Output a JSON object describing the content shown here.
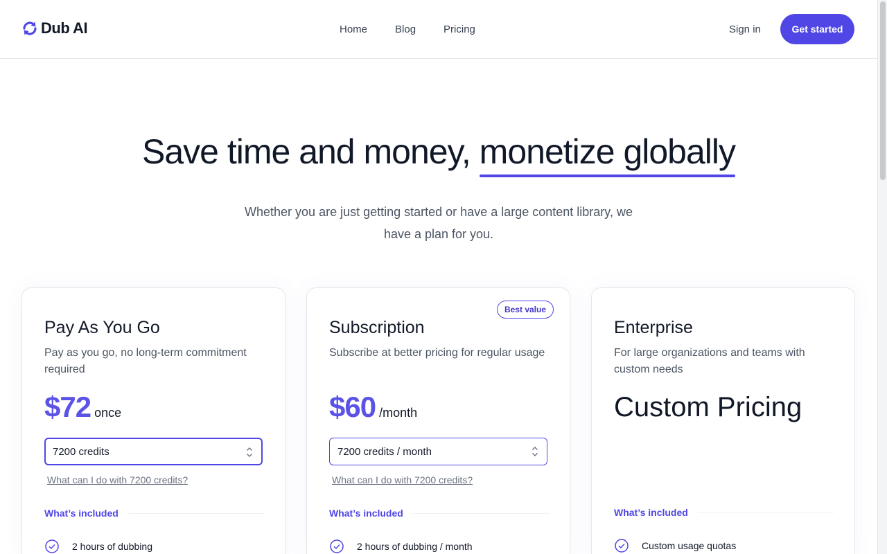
{
  "header": {
    "brand": "Dub AI",
    "nav": [
      "Home",
      "Blog",
      "Pricing"
    ],
    "sign_in": "Sign in",
    "get_started": "Get started"
  },
  "hero": {
    "title_plain": "Save time and money,",
    "title_highlight": "monetize globally",
    "subtitle": "Whether you are just getting started or have a large content library, we have a plan for you."
  },
  "plans": [
    {
      "title": "Pay As You Go",
      "description": "Pay as you go, no long-term commitment required",
      "price": "$72",
      "unit": "once",
      "selected_option": "7200 credits",
      "credits_link": "What can I do with 7200 credits?",
      "included_label": "What’s included",
      "first_feature": "2 hours of dubbing"
    },
    {
      "badge": "Best value",
      "title": "Subscription",
      "description": "Subscribe at better pricing for regular usage",
      "price": "$60",
      "unit": "/month",
      "selected_option": "7200 credits / month",
      "credits_link": "What can I do with 7200 credits?",
      "included_label": "What’s included",
      "first_feature": "2 hours of dubbing / month"
    },
    {
      "title": "Enterprise",
      "description": "For large organizations and teams with custom needs",
      "price_text": "Custom Pricing",
      "included_label": "What’s included",
      "first_feature": "Custom usage quotas"
    }
  ],
  "colors": {
    "accent": "#4f46e5",
    "price": "#5b52e6",
    "text": "#111827",
    "muted": "#4b5563"
  },
  "icons": [
    "refresh-logo-icon",
    "chevron-updown-icon",
    "check-circle-icon"
  ]
}
